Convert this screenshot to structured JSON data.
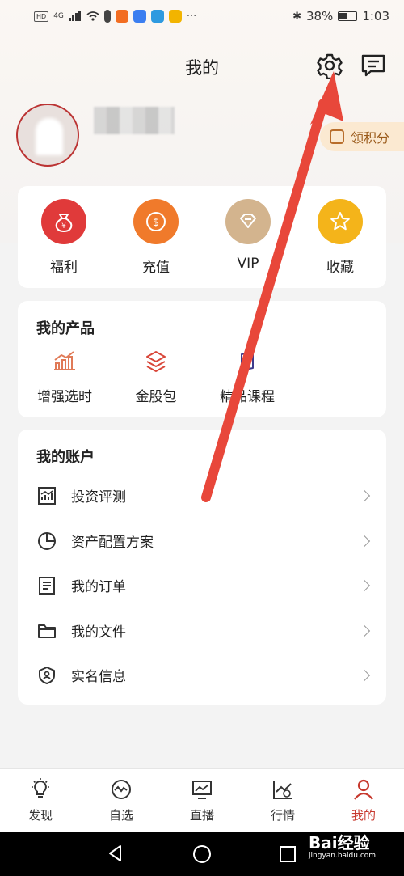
{
  "status_bar": {
    "network_badge": "HD",
    "signal_text": "4G",
    "battery_percent": "38%",
    "time": "1:03"
  },
  "header": {
    "title": "我的",
    "settings_icon": "gear-icon",
    "message_icon": "message-icon"
  },
  "profile": {
    "points_label": "领积分"
  },
  "quick_actions": [
    {
      "label": "福利",
      "icon": "money-bag-icon",
      "color": "#e03a3a"
    },
    {
      "label": "充值",
      "icon": "dollar-coin-icon",
      "color": "#f07a2b"
    },
    {
      "label": "VIP",
      "icon": "diamond-icon",
      "color": "#d3b48e"
    },
    {
      "label": "收藏",
      "icon": "star-icon",
      "color": "#f4b41a"
    }
  ],
  "products": {
    "title": "我的产品",
    "items": [
      {
        "label": "增强选时",
        "icon": "trend-chart-icon"
      },
      {
        "label": "金股包",
        "icon": "layers-icon"
      },
      {
        "label": "精品课程",
        "icon": "book-icon"
      }
    ]
  },
  "account": {
    "title": "我的账户",
    "items": [
      {
        "label": "投资评测",
        "icon": "chart-icon"
      },
      {
        "label": "资产配置方案",
        "icon": "pie-chart-icon"
      },
      {
        "label": "我的订单",
        "icon": "order-list-icon"
      },
      {
        "label": "我的文件",
        "icon": "folder-icon"
      },
      {
        "label": "实名信息",
        "icon": "shield-user-icon"
      }
    ]
  },
  "tabbar": [
    {
      "label": "发现",
      "icon": "lightbulb-icon"
    },
    {
      "label": "自选",
      "icon": "pulse-icon"
    },
    {
      "label": "直播",
      "icon": "monitor-icon"
    },
    {
      "label": "行情",
      "icon": "market-icon"
    },
    {
      "label": "我的",
      "icon": "user-icon",
      "active": true
    }
  ],
  "watermark": {
    "brand": "Bai经验",
    "url": "jingyan.baidu.com"
  },
  "colors": {
    "accent": "#c7382d",
    "annotation_arrow": "#e8473a"
  }
}
